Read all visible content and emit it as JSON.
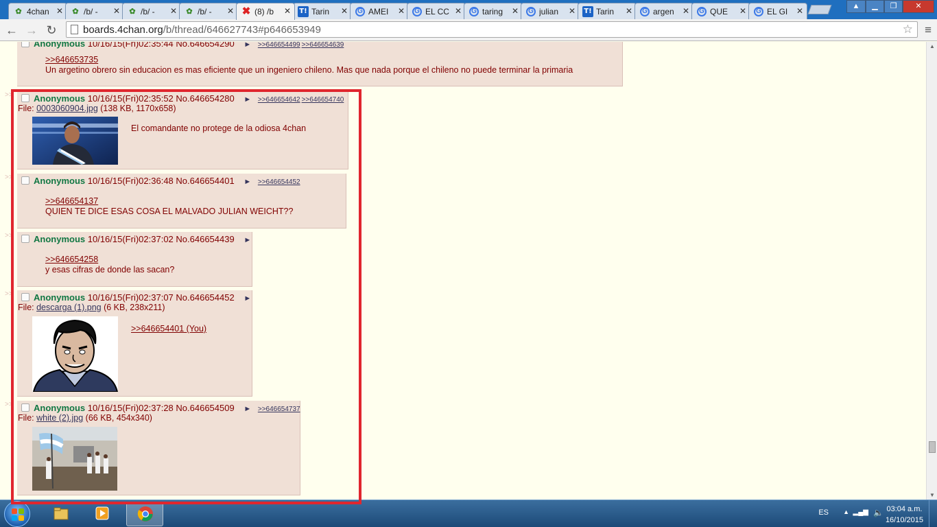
{
  "tabs": [
    {
      "label": "4chan",
      "icon": "4chan-clover-icon"
    },
    {
      "label": "/b/ -",
      "icon": "4chan-clover-icon"
    },
    {
      "label": "/b/ -",
      "icon": "4chan-clover-icon"
    },
    {
      "label": "/b/ -",
      "icon": "4chan-clover-icon"
    },
    {
      "label": "(8) /b",
      "icon": "unread-x-icon"
    },
    {
      "label": "Tarin",
      "icon": "taringa-icon"
    },
    {
      "label": "AMEI",
      "icon": "google-icon"
    },
    {
      "label": "EL CC",
      "icon": "google-icon"
    },
    {
      "label": "taring",
      "icon": "google-icon"
    },
    {
      "label": "julian",
      "icon": "google-icon"
    },
    {
      "label": "Tarin",
      "icon": "taringa-icon"
    },
    {
      "label": "argen",
      "icon": "google-icon"
    },
    {
      "label": "QUE",
      "icon": "google-icon"
    },
    {
      "label": "EL GI",
      "icon": "google-icon"
    }
  ],
  "omnibox": {
    "domain": "boards.4chan.org",
    "path": "/b/thread/646627743#p646653949"
  },
  "posts": [
    {
      "name": "Anonymous",
      "datetime": "10/16/15(Fri)02:35:44",
      "number": "No.646654290",
      "backlinks": [
        ">>646654499",
        ">>646654639"
      ],
      "quote": ">>646653735",
      "message": "Un argetino obrero sin educacion es mas eficiente que un ingeniero chileno. Mas que nada porque el chileno no puede terminar la primaria"
    },
    {
      "name": "Anonymous",
      "datetime": "10/16/15(Fri)02:35:52",
      "number": "No.646654280",
      "backlinks": [
        ">>646654642",
        ">>646654740"
      ],
      "file_prefix": "File: ",
      "file_name": "0003060904.jpg",
      "file_meta": " (138 KB, 1170x658)",
      "message": "El comandante no protege de la odiosa 4chan"
    },
    {
      "name": "Anonymous",
      "datetime": "10/16/15(Fri)02:36:48",
      "number": "No.646654401",
      "backlinks": [
        ">>646654452"
      ],
      "quote": ">>646654137",
      "message": "QUIEN TE DICE ESAS COSA EL MALVADO JULIAN WEICHT??"
    },
    {
      "name": "Anonymous",
      "datetime": "10/16/15(Fri)02:37:02",
      "number": "No.646654439",
      "quote": ">>646654258",
      "message": "y esas cifras de donde las sacan?"
    },
    {
      "name": "Anonymous",
      "datetime": "10/16/15(Fri)02:37:07",
      "number": "No.646654452",
      "file_prefix": "File: ",
      "file_name": "descarga (1).png",
      "file_meta": " (6 KB, 238x211)",
      "quote": ">>646654401 (You)"
    },
    {
      "name": "Anonymous",
      "datetime": "10/16/15(Fri)02:37:28",
      "number": "No.646654509",
      "backlinks": [
        ">>646654737"
      ],
      "file_prefix": "File: ",
      "file_name": "white (2).jpg",
      "file_meta": " (66 KB, 454x340)"
    }
  ],
  "glyphs": {
    "post_menu": "►",
    "side_arrow": ">>",
    "back": "←",
    "forward": "→",
    "reload": "↻",
    "star": "☆",
    "menu": "≡"
  },
  "taskbar": {
    "lang": "ES",
    "time": "03:04 a.m.",
    "date": "16/10/2015"
  },
  "colors": {
    "post_bg": "#f0e0d6",
    "page_bg": "#ffffee",
    "name": "#117743",
    "text": "#800000",
    "link": "#34345c",
    "highlight_box": "#e0262e"
  }
}
